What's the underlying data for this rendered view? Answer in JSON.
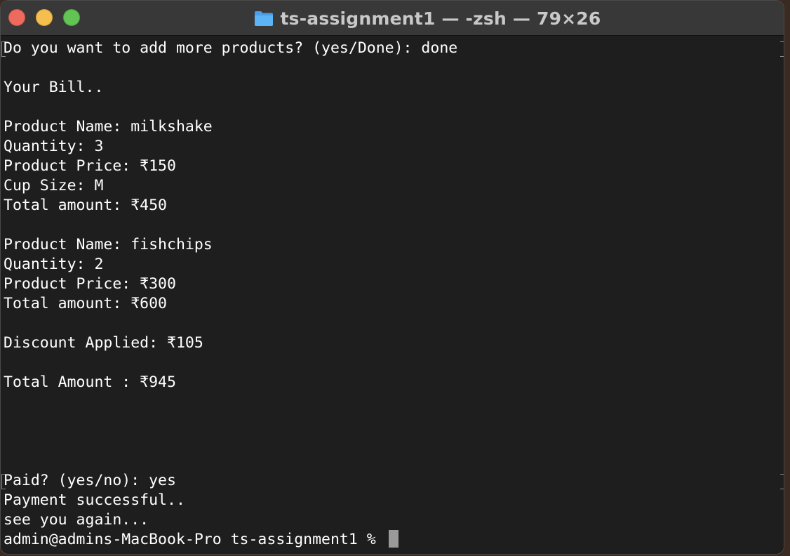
{
  "window": {
    "title": "ts-assignment1 — -zsh — 79×26",
    "folder_icon": "folder-icon"
  },
  "terminal": {
    "lines": [
      "Do you want to add more products? (yes/Done): done",
      "",
      "Your Bill..",
      "",
      "Product Name: milkshake",
      "Quantity: 3",
      "Product Price: ₹150",
      "Cup Size: M",
      "Total amount: ₹450",
      "",
      "Product Name: fishchips",
      "Quantity: 2",
      "Product Price: ₹300",
      "Total amount: ₹600",
      "",
      "Discount Applied: ₹105",
      "",
      "Total Amount : ₹945",
      "",
      "",
      "",
      "",
      "Paid? (yes/no): yes",
      "Payment successful..",
      "see you again...",
      "admin@admins-MacBook-Pro ts-assignment1 % "
    ]
  },
  "colors": {
    "background": "#1e1e1e",
    "titlebar": "#383838",
    "text": "#ffffff",
    "close": "#ed6a5e",
    "minimize": "#f5bf4f",
    "maximize": "#61c454",
    "folder": "#4a9fe8"
  }
}
